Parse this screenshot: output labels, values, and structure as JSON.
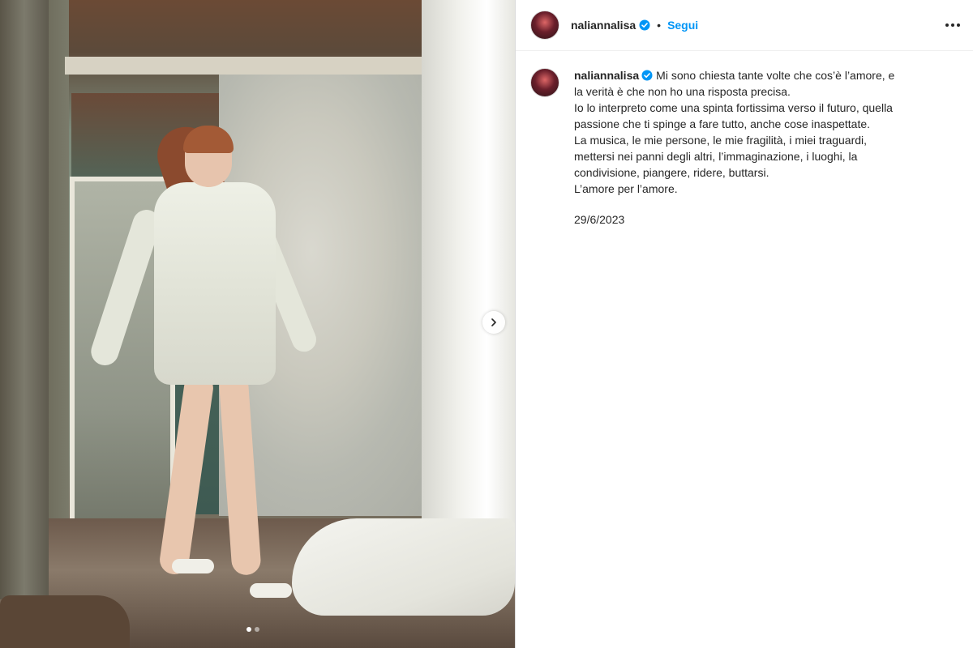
{
  "post": {
    "username": "naliannalisa",
    "follow_label": "Segui",
    "separator": "•",
    "caption_lines": [
      "Mi sono chiesta tante volte che cos’è l’amore, e la verità è che non ho una risposta precisa.",
      "Io lo interpreto come una spinta fortissima verso il futuro, quella passione che ti spinge a fare tutto, anche cose inaspettate.",
      "La musica, le mie persone, le mie fragilità, i miei traguardi, mettersi nei panni degli altri, l’immaginazione, i luoghi, la condivisione, piangere, ridere, buttarsi.",
      "L’amore per l’amore."
    ],
    "date": "29/6/2023"
  },
  "carousel": {
    "total": 2,
    "current": 1
  },
  "colors": {
    "accent": "#0095f6",
    "verified": "#0095f6",
    "text": "#262626"
  },
  "icons": {
    "verified": "verified-badge-icon",
    "more": "more-options-icon",
    "next": "chevron-right-icon"
  }
}
